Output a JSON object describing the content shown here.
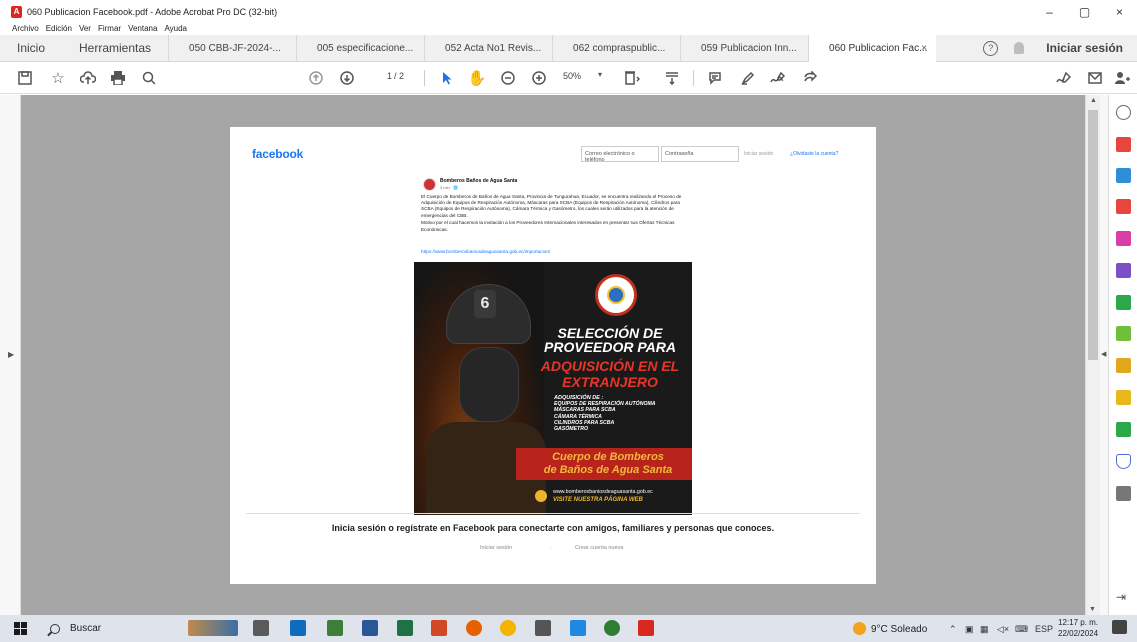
{
  "window": {
    "title": "060 Publicacion Facebook.pdf - Adobe Acrobat Pro DC (32-bit)",
    "minimize": "–",
    "maximize": "▢",
    "close": "×"
  },
  "menu": [
    "Archivo",
    "Edición",
    "Ver",
    "Firmar",
    "Ventana",
    "Ayuda"
  ],
  "tabs": {
    "home": "Inicio",
    "tools": "Herramientas",
    "documents": [
      "050 CBB-JF-2024-...",
      "005 especificacione...",
      "052 Acta No1 Revis...",
      "062 compraspublic...",
      "059 Publicacion Inn...",
      "060 Publicacion Fac..."
    ],
    "active_close": "×",
    "help": "?",
    "signin": "Iniciar sesión"
  },
  "toolbar": {
    "page_current": "1",
    "page_total": "/ 2",
    "zoom": "50%"
  },
  "facebook": {
    "logo": "facebook",
    "email_placeholder": "Correo electrónico o teléfono",
    "password_placeholder": "Contraseña",
    "login_link": "Iniciar sesión",
    "forgot_link": "¿Olvidaste la cuenta?",
    "post": {
      "author": "Bomberos Baños de Agua Santa",
      "time": "3 min · 🌐",
      "paragraph_1": "El Cuerpo de Bomberos de Baños de Agua Santa, Provincia de Tungurahua, Ecuador, se encuentra realizando el Proceso de Adquisición de Equipos de Respiración Autónoma, Máscaras para SCBA (Equipos de Respiración Autónoma), Cilindros para SCBA (Equipos de Respiración Autónoma), Cámara Térmica y Gasómetro, los cuales serán utilizados para la atención de emergencias del CBB.",
      "paragraph_2": "Motivo por el cual hacemos la invitación a los Proveedores Internacionales interesados en presentar sus Ofertas Técnicas Económicas.",
      "link": "https://www.bomberosbaniosdeaguasanta.gob.ec/importacion/"
    },
    "poster": {
      "helmet_number": "6",
      "headline_1": "SELECCIÓN DE PROVEEDOR PARA",
      "headline_2": "ADQUISICIÓN EN EL EXTRANJERO",
      "details_title": "ADQUISICIÓN DE :",
      "details": [
        "EQUIPOS DE RESPIRACIÓN AUTÓNOMA",
        "MÁSCARAS PARA SCBA",
        "CÁMARA TÉRMICA",
        "CILINDROS PARA SCBA",
        "GASÓMETRO"
      ],
      "org_line_1": "Cuerpo de Bomberos",
      "org_line_2": "de Baños de Agua Santa",
      "website": "www.bomberosbaniosdeaguasanta.gob.ec",
      "cta": "VISITE NUESTRA PÁGINA WEB"
    },
    "signup_prompt": "Inicia sesión o regístrate en Facebook para conectarte con amigos, familiares y personas que conoces.",
    "footer_login": "Iniciar sesión",
    "footer_dot": "·",
    "footer_create": "Crear cuenta nueva"
  },
  "taskbar": {
    "search": "Buscar",
    "weather": "9°C Soleado",
    "lang": "ESP",
    "time": "12:17 p. m.",
    "date": "22/02/2024"
  }
}
